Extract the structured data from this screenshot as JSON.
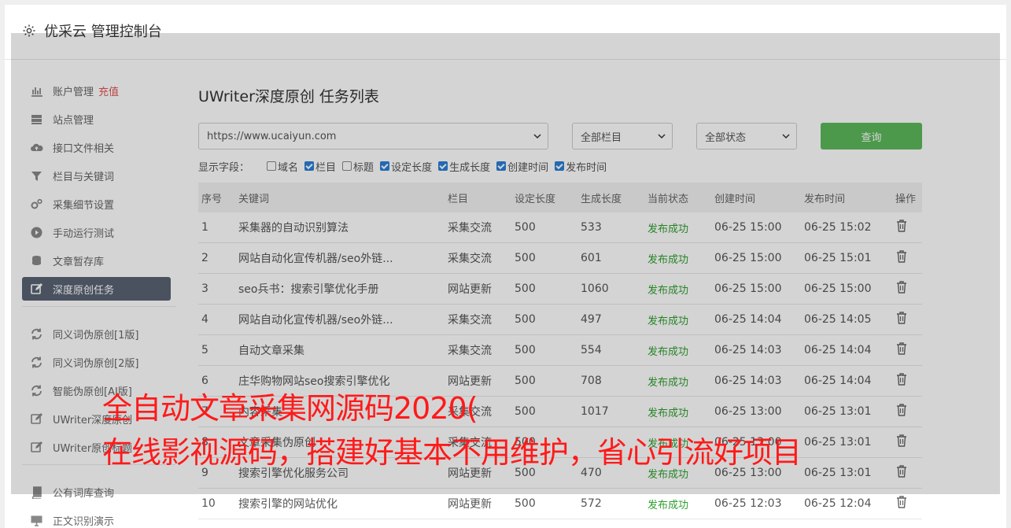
{
  "header": {
    "title": "优采云 管理控制台"
  },
  "sidebar": {
    "items": [
      {
        "label": "账户管理",
        "extra": "充值",
        "icon": "bar-chart-icon"
      },
      {
        "label": "站点管理",
        "icon": "server-icon"
      },
      {
        "label": "接口文件相关",
        "icon": "cloud-upload-icon"
      },
      {
        "label": "栏目与关键词",
        "icon": "filter-icon"
      },
      {
        "label": "采集细节设置",
        "icon": "gears-icon"
      },
      {
        "label": "手动运行测试",
        "icon": "play-circle-icon"
      },
      {
        "label": "文章暂存库",
        "icon": "database-icon"
      },
      {
        "label": "深度原创任务",
        "icon": "edit-icon",
        "active": true
      },
      {
        "label": "同义词伪原创[1版]",
        "icon": "refresh-icon"
      },
      {
        "label": "同义词伪原创[2版]",
        "icon": "refresh-icon"
      },
      {
        "label": "智能伪原创[AI版]",
        "icon": "refresh-icon"
      },
      {
        "label": "UWriter深度原创",
        "icon": "edit-icon"
      },
      {
        "label": "UWriter原创标题",
        "icon": "edit-icon"
      },
      {
        "label": "公有词库查询",
        "icon": "book-icon"
      },
      {
        "label": "正文识别演示",
        "icon": "monitor-icon"
      }
    ]
  },
  "main": {
    "title": "UWriter深度原创 任务列表",
    "site_select": "https://www.ucaiyun.com",
    "column_select": "全部栏目",
    "status_select": "全部状态",
    "query_button": "查询",
    "fields_label": "显示字段：",
    "fields": [
      {
        "label": "域名",
        "checked": false
      },
      {
        "label": "栏目",
        "checked": true
      },
      {
        "label": "标题",
        "checked": false
      },
      {
        "label": "设定长度",
        "checked": true
      },
      {
        "label": "生成长度",
        "checked": true
      },
      {
        "label": "创建时间",
        "checked": true
      },
      {
        "label": "发布时间",
        "checked": true
      }
    ],
    "table": {
      "headers": [
        "序号",
        "关键词",
        "栏目",
        "设定长度",
        "生成长度",
        "当前状态",
        "创建时间",
        "发布时间",
        "操作"
      ],
      "rows": [
        [
          "1",
          "采集器的自动识别算法",
          "采集交流",
          "500",
          "533",
          "发布成功",
          "06-25 15:00",
          "06-25 15:02"
        ],
        [
          "2",
          "网站自动化宣传机器/seo外链...",
          "采集交流",
          "500",
          "601",
          "发布成功",
          "06-25 15:00",
          "06-25 15:01"
        ],
        [
          "3",
          "seo兵书：搜索引擎优化手册",
          "网站更新",
          "500",
          "1060",
          "发布成功",
          "06-25 15:00",
          "06-25 15:00"
        ],
        [
          "4",
          "网站自动化宣传机器/seo外链...",
          "采集交流",
          "500",
          "497",
          "发布成功",
          "06-25 14:04",
          "06-25 14:05"
        ],
        [
          "5",
          "自动文章采集",
          "采集交流",
          "500",
          "554",
          "发布成功",
          "06-25 14:03",
          "06-25 14:04"
        ],
        [
          "6",
          "庄华购物网站seo搜索引擎优化",
          "网站更新",
          "500",
          "708",
          "发布成功",
          "06-25 14:03",
          "06-25 14:04"
        ],
        [
          "7",
          "内容采集",
          "采集交流",
          "500",
          "1017",
          "发布成功",
          "06-25 13:00",
          "06-25 13:01"
        ],
        [
          "8",
          "文章采集伪原创",
          "采集交流",
          "500",
          "",
          "发布成功",
          "06-25 13:00",
          "06-25 13:01"
        ],
        [
          "9",
          "搜索引擎优化服务公司",
          "网站更新",
          "500",
          "470",
          "发布成功",
          "06-25 13:00",
          "06-25 13:01"
        ],
        [
          "10",
          "搜索引擎的网站优化",
          "网站更新",
          "500",
          "572",
          "发布成功",
          "06-25 12:03",
          "06-25 12:04"
        ]
      ]
    }
  },
  "watermark": {
    "line1": "全自动文章采集网源码2020(",
    "line2": "在线影视源码，搭建好基本不用维护，省心引流好项目",
    "color": "#ff1a1a"
  }
}
